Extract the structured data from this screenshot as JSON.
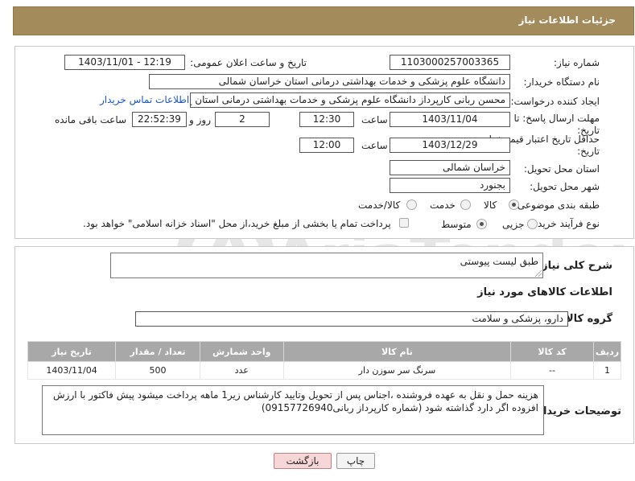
{
  "header": {
    "title": "جزئیات اطلاعات نیاز"
  },
  "form": {
    "need_number": {
      "label": "شماره نیاز:",
      "value": "1103000257003365"
    },
    "announce_datetime": {
      "label": "تاریخ و ساعت اعلان عمومی:",
      "value": "1403/11/01 - 12:19"
    },
    "buyer_org": {
      "label": "نام دستگاه خریدار:",
      "value": "دانشگاه علوم پزشکی و خدمات بهداشتی درمانی استان خراسان شمالی"
    },
    "requester": {
      "label": "ایجاد کننده درخواست:",
      "value": "محسن ربانی کارپرداز دانشگاه علوم پزشکی و خدمات بهداشتی درمانی استان خ",
      "contact_link": "اطلاعات تماس خریدار"
    },
    "reply_deadline": {
      "label_line1": "مهلت ارسال پاسخ: تا",
      "label_line2": "تاریخ:",
      "date": "1403/11/04",
      "time_label": "ساعت",
      "time": "12:30",
      "days": "2",
      "days_label": "روز و",
      "remaining": "22:52:39",
      "remaining_label": "ساعت باقی مانده"
    },
    "price_validity": {
      "label_line1": "حداقل تاریخ اعتبار قیمت: تا",
      "label_line2": "تاریخ:",
      "date": "1403/12/29",
      "time_label": "ساعت",
      "time": "12:00"
    },
    "delivery_province": {
      "label": "استان محل تحویل:",
      "value": "خراسان شمالی"
    },
    "delivery_city": {
      "label": "شهر محل تحویل:",
      "value": "بجنورد"
    },
    "category": {
      "label": "طبقه بندی موضوعی:",
      "options": [
        "کالا",
        "خدمت",
        "کالا/خدمت"
      ],
      "selected": "کالا"
    },
    "purchase_type": {
      "label": "نوع فرآیند خرید :",
      "options": [
        "جزیی",
        "متوسط"
      ],
      "selected": "متوسط",
      "note": "پرداخت تمام یا بخشی از مبلغ خرید،از محل \"اسناد خزانه اسلامی\" خواهد بود."
    }
  },
  "details": {
    "general_desc_label": "شرح کلی نیاز:",
    "general_desc_value": "طبق لیست پیوستی",
    "goods_info_title": "اطلاعات کالاهای مورد نیاز",
    "goods_group_label": "گروه کالا:",
    "goods_group_value": "دارو، پزشکی و سلامت",
    "table": {
      "columns": [
        "ردیف",
        "کد کالا",
        "نام کالا",
        "واحد شمارش",
        "تعداد / مقدار",
        "تاریخ نیاز"
      ],
      "rows": [
        [
          "1",
          "--",
          "سرنگ سر سوزن دار",
          "عدد",
          "500",
          "1403/11/04"
        ]
      ]
    },
    "buyer_notes_label": "توضیحات خریدار:",
    "buyer_notes_value": "هزینه حمل و نقل به عهده فروشنده ،اجناس پس از تحویل وتایید کارشناس زیر1 ماهه پرداخت میشود پیش فاکتور با ارزش افزوده اگر دارد گذاشته شود (شماره کارپرداز ربانی09157726940)"
  },
  "buttons": {
    "print": "چاپ",
    "back": "بازگشت"
  },
  "watermark": {
    "text": "AriaTender.neT"
  },
  "colors": {
    "header": "#a38b5c",
    "table_header": "#a8a8a8",
    "link": "#1a57c5",
    "back_button": "#f6d6d6"
  }
}
